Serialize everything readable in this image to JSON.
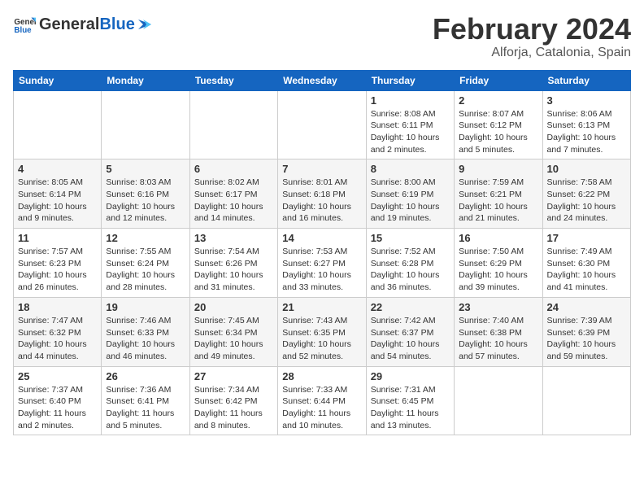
{
  "header": {
    "logo_general": "General",
    "logo_blue": "Blue",
    "month_title": "February 2024",
    "location": "Alforja, Catalonia, Spain"
  },
  "weekdays": [
    "Sunday",
    "Monday",
    "Tuesday",
    "Wednesday",
    "Thursday",
    "Friday",
    "Saturday"
  ],
  "weeks": [
    [
      {
        "day": "",
        "info": ""
      },
      {
        "day": "",
        "info": ""
      },
      {
        "day": "",
        "info": ""
      },
      {
        "day": "",
        "info": ""
      },
      {
        "day": "1",
        "info": "Sunrise: 8:08 AM\nSunset: 6:11 PM\nDaylight: 10 hours\nand 2 minutes."
      },
      {
        "day": "2",
        "info": "Sunrise: 8:07 AM\nSunset: 6:12 PM\nDaylight: 10 hours\nand 5 minutes."
      },
      {
        "day": "3",
        "info": "Sunrise: 8:06 AM\nSunset: 6:13 PM\nDaylight: 10 hours\nand 7 minutes."
      }
    ],
    [
      {
        "day": "4",
        "info": "Sunrise: 8:05 AM\nSunset: 6:14 PM\nDaylight: 10 hours\nand 9 minutes."
      },
      {
        "day": "5",
        "info": "Sunrise: 8:03 AM\nSunset: 6:16 PM\nDaylight: 10 hours\nand 12 minutes."
      },
      {
        "day": "6",
        "info": "Sunrise: 8:02 AM\nSunset: 6:17 PM\nDaylight: 10 hours\nand 14 minutes."
      },
      {
        "day": "7",
        "info": "Sunrise: 8:01 AM\nSunset: 6:18 PM\nDaylight: 10 hours\nand 16 minutes."
      },
      {
        "day": "8",
        "info": "Sunrise: 8:00 AM\nSunset: 6:19 PM\nDaylight: 10 hours\nand 19 minutes."
      },
      {
        "day": "9",
        "info": "Sunrise: 7:59 AM\nSunset: 6:21 PM\nDaylight: 10 hours\nand 21 minutes."
      },
      {
        "day": "10",
        "info": "Sunrise: 7:58 AM\nSunset: 6:22 PM\nDaylight: 10 hours\nand 24 minutes."
      }
    ],
    [
      {
        "day": "11",
        "info": "Sunrise: 7:57 AM\nSunset: 6:23 PM\nDaylight: 10 hours\nand 26 minutes."
      },
      {
        "day": "12",
        "info": "Sunrise: 7:55 AM\nSunset: 6:24 PM\nDaylight: 10 hours\nand 28 minutes."
      },
      {
        "day": "13",
        "info": "Sunrise: 7:54 AM\nSunset: 6:26 PM\nDaylight: 10 hours\nand 31 minutes."
      },
      {
        "day": "14",
        "info": "Sunrise: 7:53 AM\nSunset: 6:27 PM\nDaylight: 10 hours\nand 33 minutes."
      },
      {
        "day": "15",
        "info": "Sunrise: 7:52 AM\nSunset: 6:28 PM\nDaylight: 10 hours\nand 36 minutes."
      },
      {
        "day": "16",
        "info": "Sunrise: 7:50 AM\nSunset: 6:29 PM\nDaylight: 10 hours\nand 39 minutes."
      },
      {
        "day": "17",
        "info": "Sunrise: 7:49 AM\nSunset: 6:30 PM\nDaylight: 10 hours\nand 41 minutes."
      }
    ],
    [
      {
        "day": "18",
        "info": "Sunrise: 7:47 AM\nSunset: 6:32 PM\nDaylight: 10 hours\nand 44 minutes."
      },
      {
        "day": "19",
        "info": "Sunrise: 7:46 AM\nSunset: 6:33 PM\nDaylight: 10 hours\nand 46 minutes."
      },
      {
        "day": "20",
        "info": "Sunrise: 7:45 AM\nSunset: 6:34 PM\nDaylight: 10 hours\nand 49 minutes."
      },
      {
        "day": "21",
        "info": "Sunrise: 7:43 AM\nSunset: 6:35 PM\nDaylight: 10 hours\nand 52 minutes."
      },
      {
        "day": "22",
        "info": "Sunrise: 7:42 AM\nSunset: 6:37 PM\nDaylight: 10 hours\nand 54 minutes."
      },
      {
        "day": "23",
        "info": "Sunrise: 7:40 AM\nSunset: 6:38 PM\nDaylight: 10 hours\nand 57 minutes."
      },
      {
        "day": "24",
        "info": "Sunrise: 7:39 AM\nSunset: 6:39 PM\nDaylight: 10 hours\nand 59 minutes."
      }
    ],
    [
      {
        "day": "25",
        "info": "Sunrise: 7:37 AM\nSunset: 6:40 PM\nDaylight: 11 hours\nand 2 minutes."
      },
      {
        "day": "26",
        "info": "Sunrise: 7:36 AM\nSunset: 6:41 PM\nDaylight: 11 hours\nand 5 minutes."
      },
      {
        "day": "27",
        "info": "Sunrise: 7:34 AM\nSunset: 6:42 PM\nDaylight: 11 hours\nand 8 minutes."
      },
      {
        "day": "28",
        "info": "Sunrise: 7:33 AM\nSunset: 6:44 PM\nDaylight: 11 hours\nand 10 minutes."
      },
      {
        "day": "29",
        "info": "Sunrise: 7:31 AM\nSunset: 6:45 PM\nDaylight: 11 hours\nand 13 minutes."
      },
      {
        "day": "",
        "info": ""
      },
      {
        "day": "",
        "info": ""
      }
    ]
  ]
}
